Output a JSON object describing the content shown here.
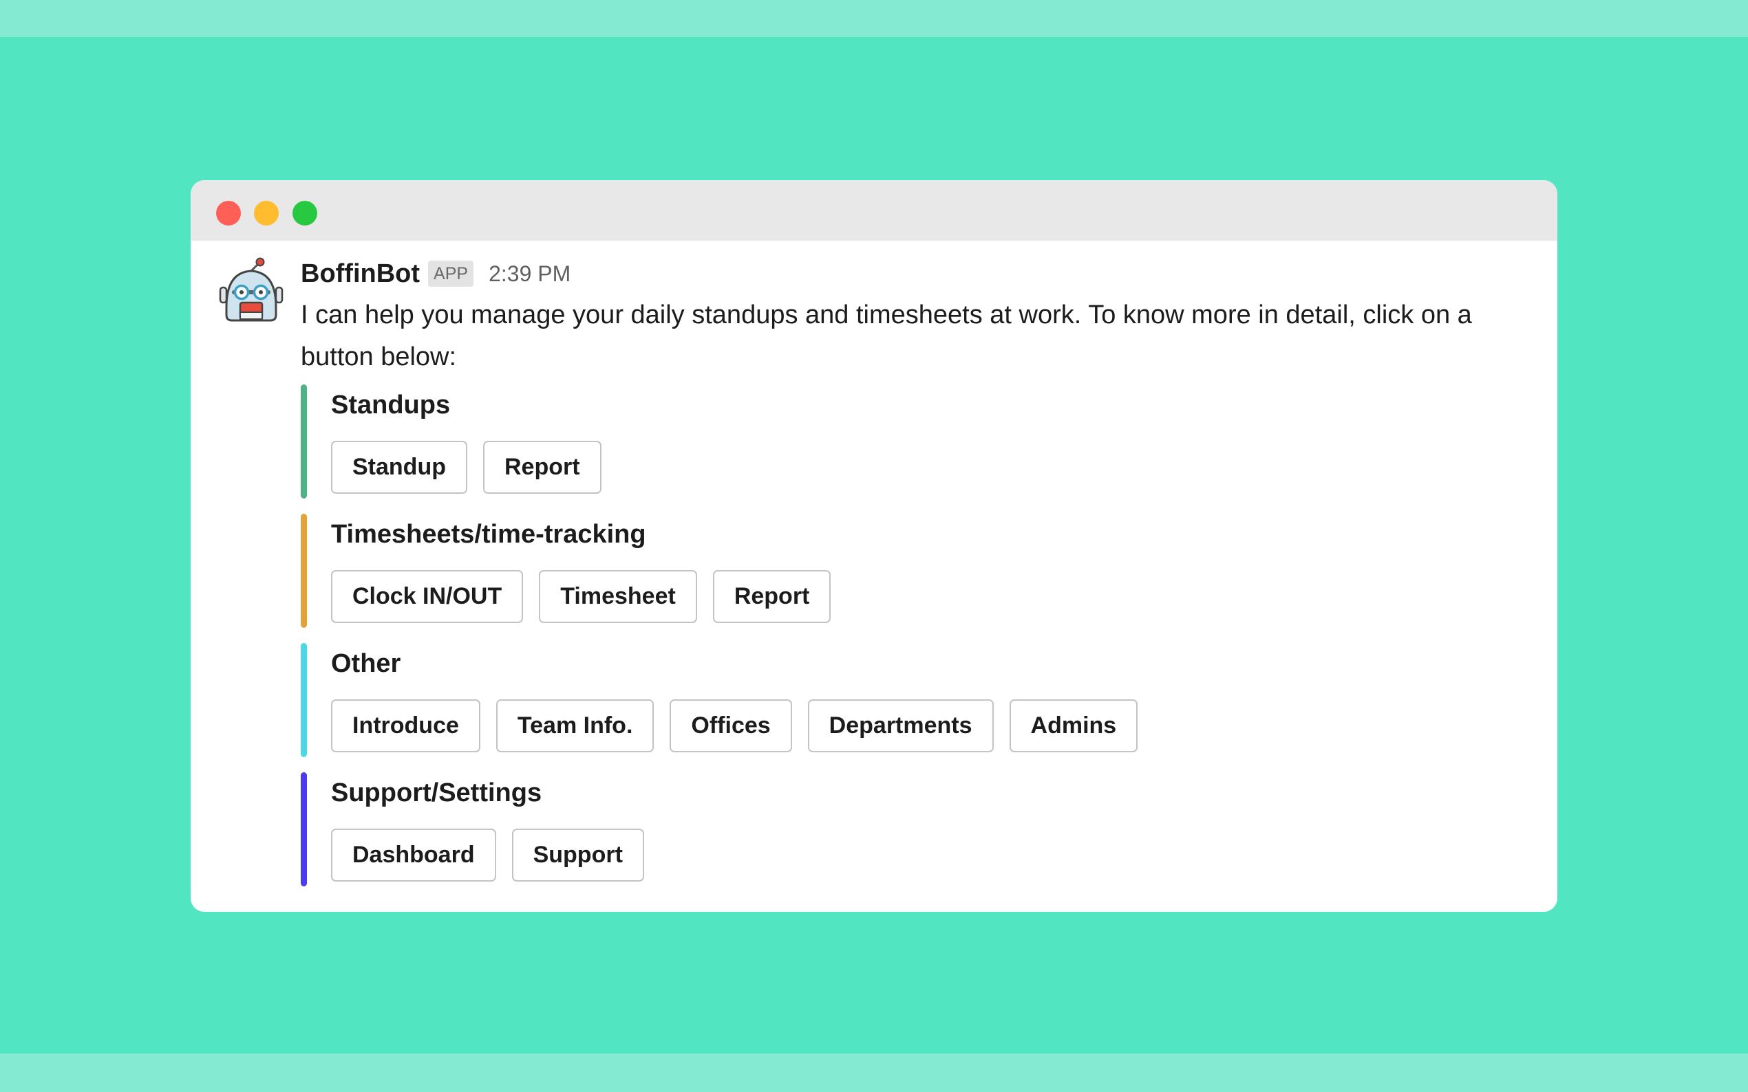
{
  "window": {
    "controls": [
      "close",
      "minimize",
      "maximize"
    ]
  },
  "message": {
    "avatar_icon": "robot-icon",
    "sender": "BoffinBot",
    "badge": "APP",
    "time": "2:39 PM",
    "text": "I can help you manage your daily standups and timesheets at work. To know more in detail, click on a button below:"
  },
  "sections": [
    {
      "title": "Standups",
      "color": "#4fb286",
      "buttons": [
        "Standup",
        "Report"
      ]
    },
    {
      "title": "Timesheets/time-tracking",
      "color": "#e3a33c",
      "buttons": [
        "Clock IN/OUT",
        "Timesheet",
        "Report"
      ]
    },
    {
      "title": "Other",
      "color": "#4ed8e6",
      "buttons": [
        "Introduce",
        "Team Info.",
        "Offices",
        "Departments",
        "Admins"
      ]
    },
    {
      "title": "Support/Settings",
      "color": "#4c3cf0",
      "buttons": [
        "Dashboard",
        "Support"
      ]
    }
  ]
}
